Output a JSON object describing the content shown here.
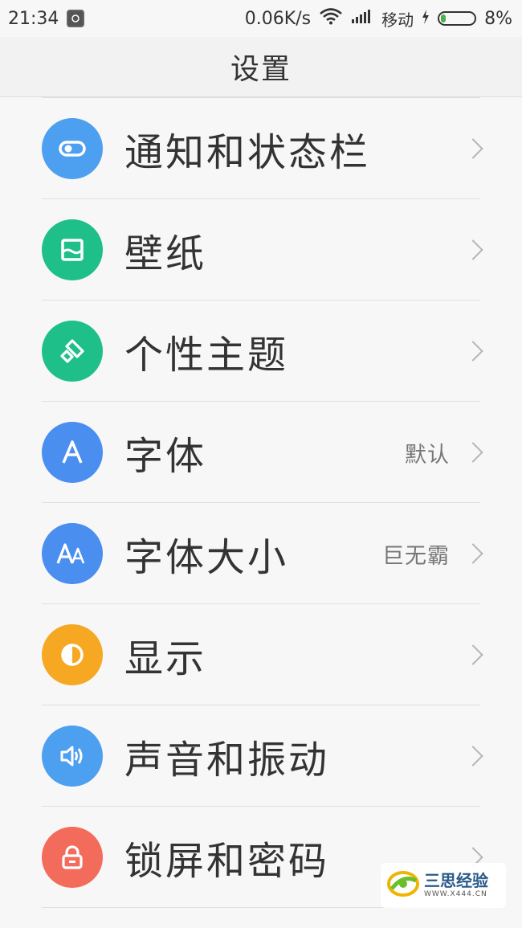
{
  "status_bar": {
    "time": "21:34",
    "speed": "0.06K/s",
    "carrier": "移动",
    "battery_percent_text": "8%",
    "battery_level": 0.08
  },
  "header": {
    "title": "设置"
  },
  "settings": {
    "items": [
      {
        "label": "通知和状态栏",
        "value": "",
        "icon": "toggle-icon",
        "color": "#4d9ff0"
      },
      {
        "label": "壁纸",
        "value": "",
        "icon": "wallpaper-icon",
        "color": "#1fbf8a"
      },
      {
        "label": "个性主题",
        "value": "",
        "icon": "brush-icon",
        "color": "#1fbf8a"
      },
      {
        "label": "字体",
        "value": "默认",
        "icon": "font-icon",
        "color": "#4a8ef0"
      },
      {
        "label": "字体大小",
        "value": "巨无霸",
        "icon": "font-size-icon",
        "color": "#4a8ef0"
      },
      {
        "label": "显示",
        "value": "",
        "icon": "display-icon",
        "color": "#f7a823"
      },
      {
        "label": "声音和振动",
        "value": "",
        "icon": "sound-icon",
        "color": "#4d9ff0"
      },
      {
        "label": "锁屏和密码",
        "value": "",
        "icon": "lock-icon",
        "color": "#f26b5b"
      }
    ]
  },
  "watermark": {
    "title": "三思经验",
    "subtitle": "WWW.X444.CN"
  }
}
